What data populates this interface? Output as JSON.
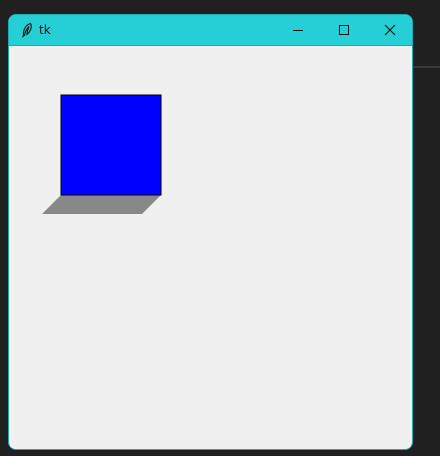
{
  "window": {
    "title": "tk",
    "app_icon": "feather-icon",
    "controls": [
      "minimize-icon",
      "maximize-icon",
      "close-icon"
    ],
    "titlebar_color": "#26cfd6"
  },
  "canvas": {
    "background": "#f0f0f0",
    "square_color": "#0000ff",
    "shadow_color": "#888888"
  }
}
